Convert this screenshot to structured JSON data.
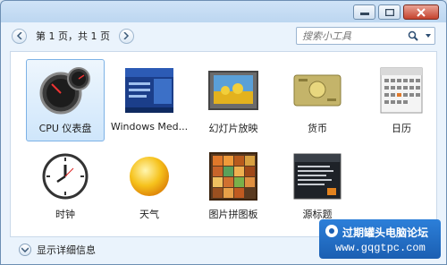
{
  "window": {
    "controls": [
      {
        "name": "minimize-button",
        "icon": "minimize-icon"
      },
      {
        "name": "maximize-button",
        "icon": "maximize-icon"
      },
      {
        "name": "close-button",
        "icon": "close-icon"
      }
    ]
  },
  "toolbar": {
    "page_info": "第 1 页，共 1 页",
    "search_placeholder": "搜索小工具"
  },
  "gadgets": [
    {
      "label": "CPU 仪表盘",
      "icon": "cpu-meter-icon",
      "selected": true
    },
    {
      "label": "Windows Med...",
      "icon": "windows-media-center-icon",
      "selected": false
    },
    {
      "label": "幻灯片放映",
      "icon": "slideshow-icon",
      "selected": false
    },
    {
      "label": "货币",
      "icon": "currency-icon",
      "selected": false
    },
    {
      "label": "日历",
      "icon": "calendar-icon",
      "selected": false
    },
    {
      "label": "时钟",
      "icon": "clock-icon",
      "selected": false
    },
    {
      "label": "天气",
      "icon": "weather-icon",
      "selected": false
    },
    {
      "label": "图片拼图板",
      "icon": "picture-puzzle-icon",
      "selected": false
    },
    {
      "label": "源标题",
      "icon": "feed-headlines-icon",
      "selected": false
    }
  ],
  "status": {
    "label": "显示详细信息"
  },
  "watermark": {
    "title": "过期罐头电脑论坛",
    "url": "www.gqgtpc.com"
  },
  "colors": {
    "selection": "#cfe6fb",
    "selection_border": "#7db2e6",
    "watermark_bg": "#1b5fb2"
  }
}
